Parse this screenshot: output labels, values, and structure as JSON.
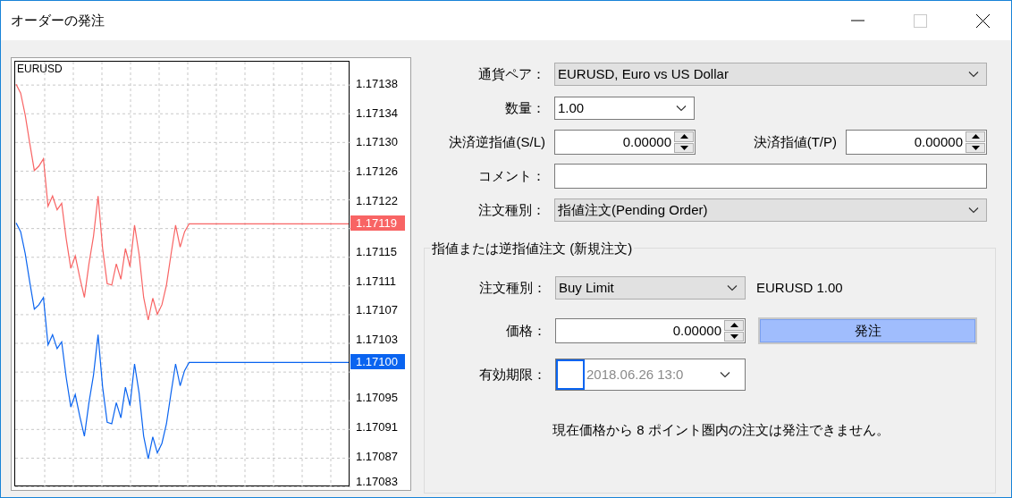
{
  "window": {
    "title": "オーダーの発注"
  },
  "chart": {
    "symbol": "EURUSD",
    "price_tags": [
      {
        "text": "1.17119",
        "color": "#f86464"
      },
      {
        "text": "1.17100",
        "color": "#0a64f0"
      }
    ],
    "chart_data": {
      "type": "line",
      "ylim": [
        1.170829,
        1.171412
      ],
      "grid": true,
      "categories": [
        null,
        null,
        null,
        null,
        null,
        null,
        null,
        null,
        null,
        null,
        null,
        null,
        null,
        null,
        null,
        null,
        null,
        null,
        null,
        null,
        null,
        null,
        null,
        null,
        null,
        null,
        null,
        null,
        null,
        null,
        null,
        null,
        null,
        null,
        null,
        null,
        null,
        null,
        null,
        null,
        null,
        null,
        null,
        null,
        null,
        null,
        null,
        null,
        null,
        null,
        null,
        null,
        null,
        null,
        null,
        null,
        null,
        null,
        null,
        null,
        null,
        null,
        null,
        null,
        null,
        null,
        null,
        null,
        null,
        null,
        null,
        null,
        null,
        null
      ],
      "series": [
        {
          "color": "#f86464",
          "values": [
            1.171381,
            1.171369,
            1.171339,
            1.1713,
            1.171263,
            1.171269,
            1.171279,
            1.171214,
            1.171228,
            1.171209,
            1.171218,
            1.171169,
            1.171129,
            1.171146,
            1.171116,
            1.171089,
            1.171135,
            1.171173,
            1.171228,
            1.171156,
            1.171108,
            1.171106,
            1.171135,
            1.171114,
            1.171156,
            1.171131,
            1.171188,
            1.171148,
            1.171089,
            1.171058,
            1.171088,
            1.171066,
            1.171079,
            1.171106,
            1.171148,
            1.171188,
            1.171158,
            1.171179,
            1.17119,
            1.17119,
            1.17119,
            1.17119,
            1.17119,
            1.17119,
            1.17119,
            1.17119,
            1.17119,
            1.17119,
            1.17119,
            1.17119,
            1.17119,
            1.17119,
            1.17119,
            1.17119,
            1.17119,
            1.17119,
            1.17119,
            1.17119,
            1.17119,
            1.17119,
            1.17119,
            1.17119,
            1.17119,
            1.17119,
            1.17119,
            1.17119,
            1.17119,
            1.17119,
            1.17119,
            1.17119,
            1.17119,
            1.17119,
            1.17119,
            1.17119
          ]
        },
        {
          "color": "#0a64f0",
          "values": [
            1.171191,
            1.171179,
            1.171149,
            1.17111,
            1.171073,
            1.171079,
            1.171089,
            1.171024,
            1.171038,
            1.171019,
            1.171028,
            1.170979,
            1.170939,
            1.170956,
            1.170926,
            1.170899,
            1.170945,
            1.170983,
            1.171038,
            1.170966,
            1.170918,
            1.170916,
            1.170945,
            1.170924,
            1.170966,
            1.170941,
            1.170998,
            1.170958,
            1.170899,
            1.170868,
            1.170898,
            1.170876,
            1.170889,
            1.170916,
            1.170958,
            1.170998,
            1.170968,
            1.170989,
            1.171,
            1.171,
            1.171,
            1.171,
            1.171,
            1.171,
            1.171,
            1.171,
            1.171,
            1.171,
            1.171,
            1.171,
            1.171,
            1.171,
            1.171,
            1.171,
            1.171,
            1.171,
            1.171,
            1.171,
            1.171,
            1.171,
            1.171,
            1.171,
            1.171,
            1.171,
            1.171,
            1.171,
            1.171,
            1.171,
            1.171,
            1.171,
            1.171,
            1.171,
            1.171,
            1.171
          ]
        }
      ],
      "yticks": [
        {
          "value": 1.17138,
          "label": "1.17138"
        },
        {
          "value": 1.17134,
          "label": "1.17134"
        },
        {
          "value": 1.1713,
          "label": "1.17130"
        },
        {
          "value": 1.17126,
          "label": "1.17126"
        },
        {
          "value": 1.17122,
          "label": "1.17122"
        },
        {
          "value": 1.17115,
          "label": "1.17115"
        },
        {
          "value": 1.17111,
          "label": "1.17111"
        },
        {
          "value": 1.17107,
          "label": "1.17107"
        },
        {
          "value": 1.17103,
          "label": "1.17103"
        },
        {
          "value": 1.17095,
          "label": "1.17095"
        },
        {
          "value": 1.17091,
          "label": "1.17091"
        },
        {
          "value": 1.17087,
          "label": "1.17087"
        },
        {
          "value": 1.17083,
          "label": "1.17083"
        }
      ]
    }
  },
  "order_rows": [
    {
      "kind": "dropdown",
      "label": "通貨ペア：",
      "value": "EURUSD, Euro vs US Dollar"
    },
    {
      "kind": "combo",
      "label": "数量：",
      "value": "1.00"
    },
    {
      "kind": "spin_pair",
      "label": "決済逆指値(S/L)",
      "value": "0.00000",
      "label_2": "決済指値(T/P)",
      "value_2": "0.00000"
    },
    {
      "kind": "text",
      "label": "コメント："
    },
    {
      "kind": "dropdown",
      "label": "注文種別：",
      "value": "指値注文(Pending Order)"
    }
  ],
  "pending": {
    "legend": "指値または逆指値注文 (新規注文)",
    "rows": [
      {
        "kind": "dropdown",
        "label": "注文種別：",
        "value": "Buy Limit",
        "note": "EURUSD 1.00"
      },
      {
        "kind": "spin",
        "label": "価格：",
        "value": "0.00000",
        "button": "発注"
      },
      {
        "kind": "date",
        "label": "有効期限：",
        "value": "2018.06.26 13:0",
        "checked": false
      }
    ],
    "message": "現在価格から 8 ポイント圏内の注文は発注できません。"
  }
}
